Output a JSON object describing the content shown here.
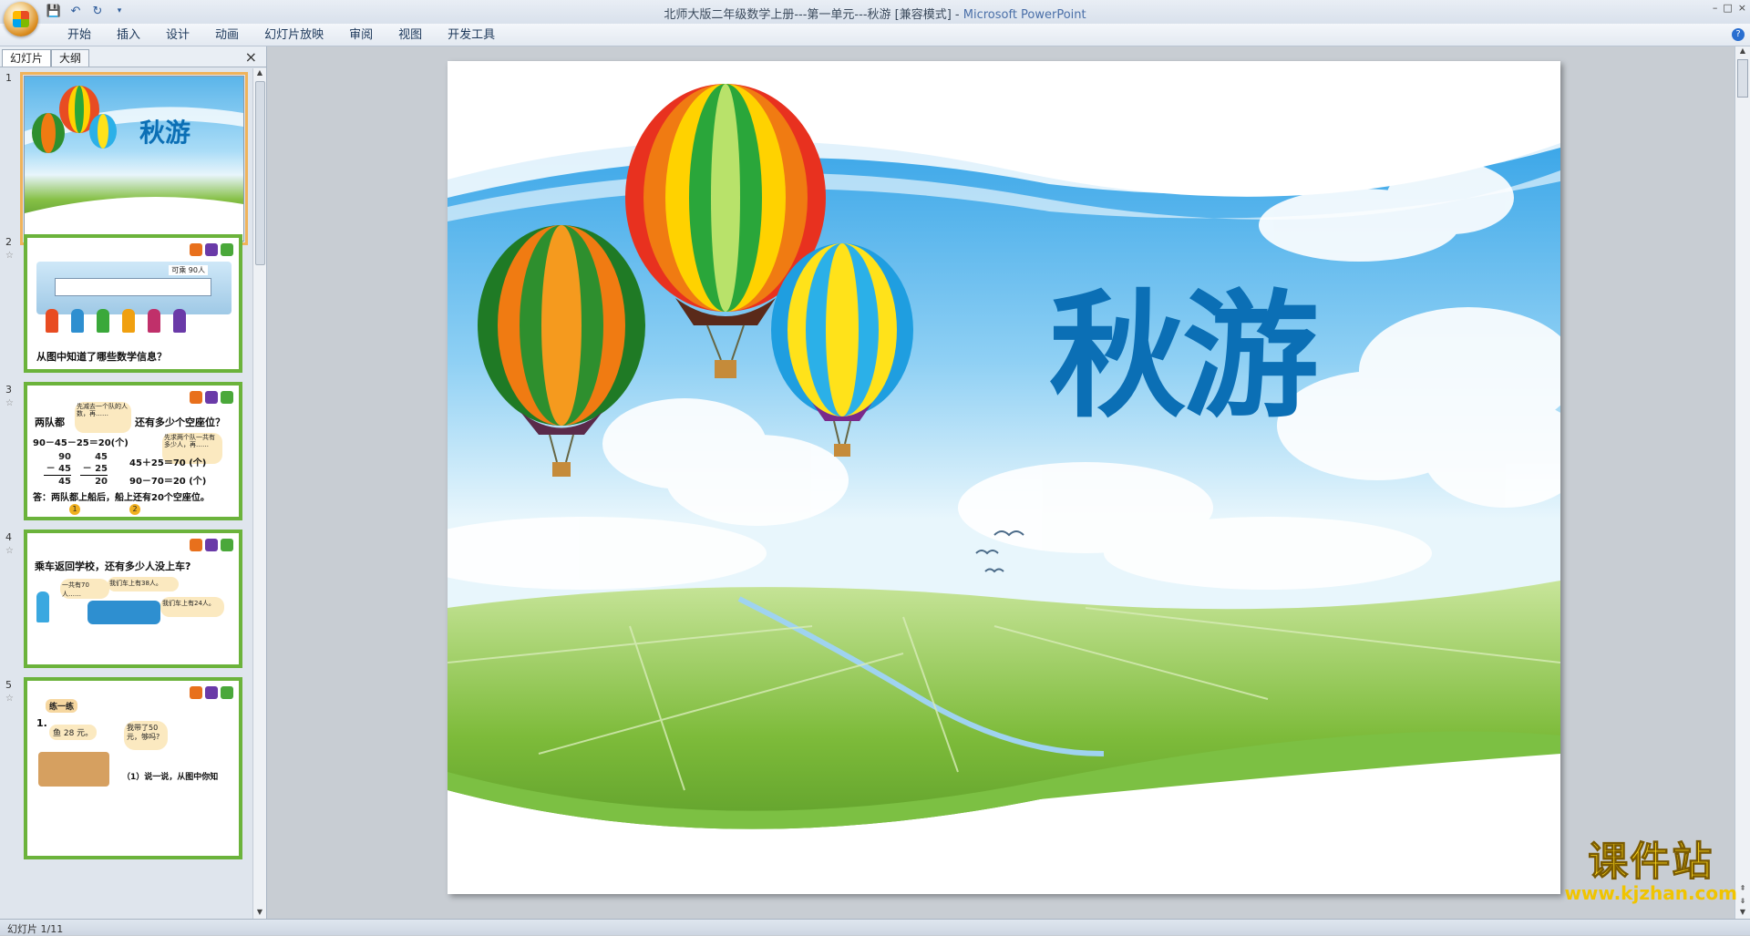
{
  "window": {
    "title": "北师大版二年级数学上册---第一单元---秋游 [兼容模式] - ",
    "app_name": "Microsoft PowerPoint",
    "controls": [
      "–",
      "□",
      "×"
    ]
  },
  "quick_access": [
    "save-icon",
    "undo-icon",
    "redo-icon",
    "customize-icon"
  ],
  "ribbon": {
    "tabs": [
      "开始",
      "插入",
      "设计",
      "动画",
      "幻灯片放映",
      "审阅",
      "视图",
      "开发工具"
    ]
  },
  "left_pane": {
    "tabs": [
      "幻灯片",
      "大纲"
    ],
    "slides": [
      {
        "number": "1",
        "thumb_title": "秋游"
      },
      {
        "number": "2",
        "caption": "从图中知道了哪些数学信息？",
        "sign_text": "可乘 90人"
      },
      {
        "number": "3",
        "lines": [
          "两队都",
          "还有多少个空座位？",
          "90－45－25＝20(个)",
          "45＋25＝70 (个)",
          "90－70＝20 (个)",
          "答：两队都上船后，船上还有20个空座位。"
        ],
        "bubble1": "先减去一个队的人数，再……",
        "bubble2": "先求两个队一共有多少人，再……",
        "col1": [
          "90",
          "－ 45",
          "45"
        ],
        "col2": [
          "45",
          "－ 25",
          "20"
        ],
        "badges": [
          "1",
          "2"
        ]
      },
      {
        "number": "4",
        "caption": "乘车返回学校，还有多少人没上车?",
        "bubble1": "一共有70人……",
        "bubble2": "我们车上有38人。",
        "bubble3": "我们车上有24人。"
      },
      {
        "number": "5",
        "tag": "练一练",
        "item": "1.",
        "price": "鱼 28 元。",
        "bubble": "我带了50元，够吗?",
        "question": "（1）说一说，从图中你知"
      }
    ]
  },
  "slide": {
    "title": "秋游"
  },
  "status": {
    "slide_counter": "幻灯片 1/11"
  },
  "watermark": {
    "title": "课件站",
    "url": "www.kjzhan.com"
  },
  "colors": {
    "title_blue": "#0b6fb5",
    "sky": "#5bb8ee",
    "field_green": "#7dbb3a",
    "thumb_border_green": "#6bb33b",
    "selected_outline": "#f0b35a"
  }
}
